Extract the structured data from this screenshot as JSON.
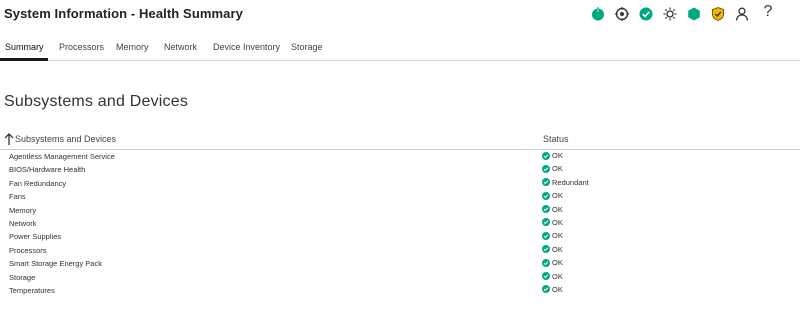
{
  "header": {
    "title": "System Information - Health Summary",
    "icons": [
      {
        "name": "power-status-icon",
        "color": "#01a982"
      },
      {
        "name": "uid-target-icon",
        "color": "#333333"
      },
      {
        "name": "health-ok-icon",
        "color": "#01a982"
      },
      {
        "name": "brightness-icon",
        "color": "#333333"
      },
      {
        "name": "hexagon-status-icon",
        "color": "#01a982"
      },
      {
        "name": "security-shield-icon",
        "color": "#f2b705"
      },
      {
        "name": "user-icon",
        "color": "#333333"
      },
      {
        "name": "help-icon",
        "color": "#333333"
      }
    ],
    "help_glyph": "?"
  },
  "tabs": [
    {
      "label": "Summary",
      "active": true
    },
    {
      "label": "Processors",
      "active": false
    },
    {
      "label": "Memory",
      "active": false
    },
    {
      "label": "Network",
      "active": false
    },
    {
      "label": "Device Inventory",
      "active": false
    },
    {
      "label": "Storage",
      "active": false
    }
  ],
  "main": {
    "section_title": "Subsystems and Devices",
    "table": {
      "columns": [
        "Subsystems and Devices",
        "Status"
      ],
      "sort_icon": "arrow-up-icon",
      "rows": [
        {
          "name": "Agentless Management Service",
          "status": "OK"
        },
        {
          "name": "BIOS/Hardware Health",
          "status": "OK"
        },
        {
          "name": "Fan Redundancy",
          "status": "Redundant"
        },
        {
          "name": "Fans",
          "status": "OK"
        },
        {
          "name": "Memory",
          "status": "OK"
        },
        {
          "name": "Network",
          "status": "OK"
        },
        {
          "name": "Power Supplies",
          "status": "OK"
        },
        {
          "name": "Processors",
          "status": "OK"
        },
        {
          "name": "Smart Storage Energy Pack",
          "status": "OK"
        },
        {
          "name": "Storage",
          "status": "OK"
        },
        {
          "name": "Temperatures",
          "status": "OK"
        }
      ]
    }
  },
  "colors": {
    "ok_green": "#01a982",
    "text": "#333333"
  }
}
